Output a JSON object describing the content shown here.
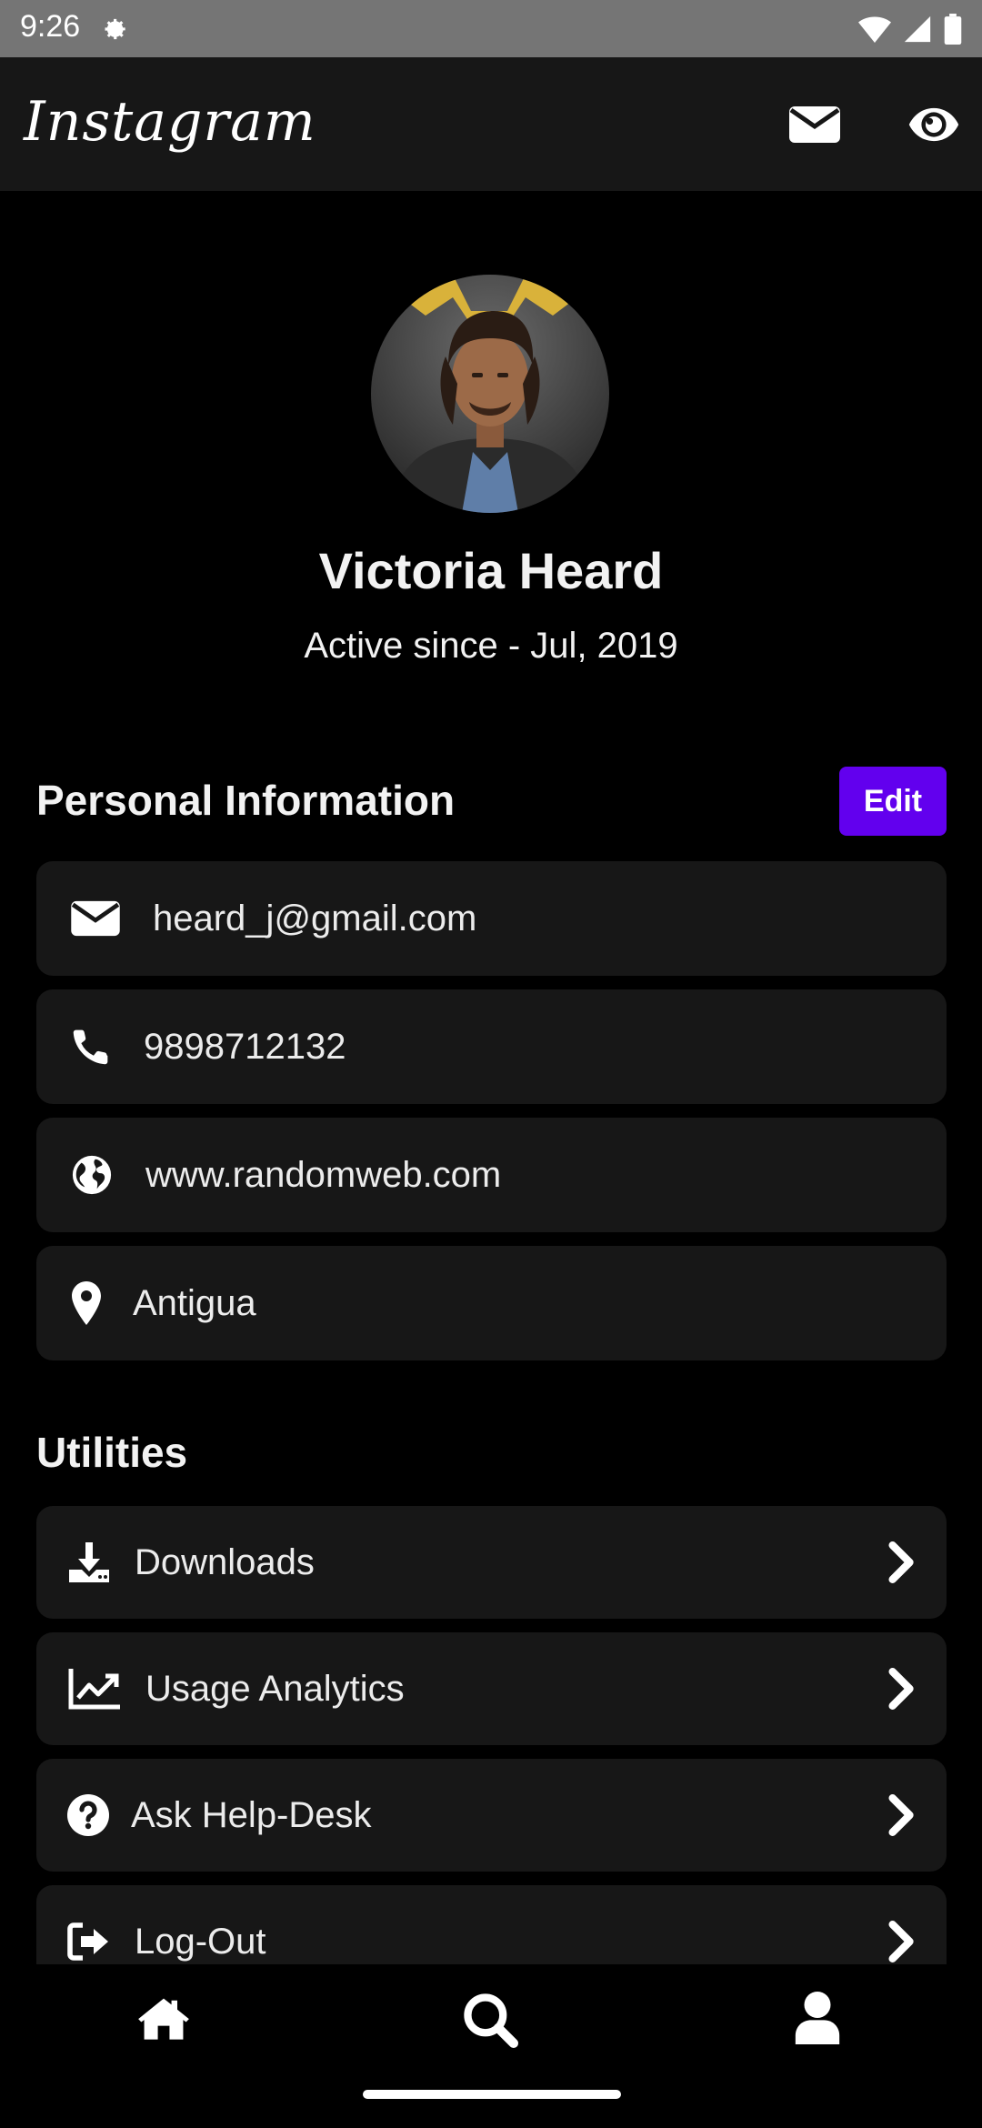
{
  "status_bar": {
    "time": "9:26"
  },
  "app_bar": {
    "logo_text": "Instagram",
    "mail_icon": "envelope-icon",
    "eye_icon": "eye-icon"
  },
  "profile": {
    "name": "Victoria Heard",
    "active_since": "Active since - Jul, 2019"
  },
  "personal_info": {
    "title": "Personal Information",
    "edit_label": "Edit",
    "items": [
      {
        "icon": "envelope-icon",
        "text": "heard_j@gmail.com"
      },
      {
        "icon": "phone-icon",
        "text": "9898712132"
      },
      {
        "icon": "globe-icon",
        "text": "www.randomweb.com"
      },
      {
        "icon": "map-pin-icon",
        "text": "Antigua"
      }
    ]
  },
  "utilities": {
    "title": "Utilities",
    "items": [
      {
        "icon": "download-icon",
        "label": "Downloads"
      },
      {
        "icon": "chart-line-icon",
        "label": "Usage Analytics"
      },
      {
        "icon": "question-circle-icon",
        "label": "Ask Help-Desk"
      },
      {
        "icon": "sign-out-icon",
        "label": "Log-Out"
      }
    ]
  },
  "bottom_nav": {
    "items": [
      "home-icon",
      "search-icon",
      "user-icon"
    ]
  },
  "colors": {
    "background": "#000000",
    "card": "#171717",
    "accent": "#6200ee",
    "status_bar": "#757575"
  }
}
